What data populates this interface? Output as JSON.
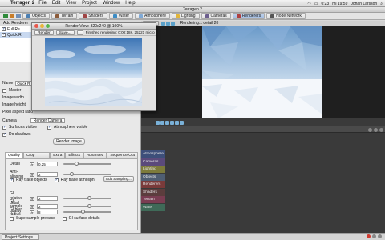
{
  "menubar": {
    "app": "Terragen 2",
    "items": [
      "File",
      "Edit",
      "View",
      "Project",
      "Window",
      "Help"
    ],
    "battery": "0:23",
    "clock": "mi 19:59",
    "user": "Johan Larsson"
  },
  "window": {
    "title": "Terragen 2"
  },
  "toolbar": {
    "tabs": [
      "Objects",
      "Terrain",
      "Shaders",
      "Water",
      "Atmosphere",
      "Lighting",
      "Cameras",
      "Renderers",
      "Node Network"
    ],
    "active_tab": "Renderers"
  },
  "left": {
    "add_renderer": "Add Renderer",
    "renderers": [
      "Full Re",
      "Quick R"
    ],
    "name_label": "Name",
    "name_value": "Quick R",
    "master_label": "Master",
    "image_width_label": "Image width",
    "image_height_label": "Image height",
    "pixel_aspect_label": "Pixel aspect ratio",
    "camera_label": "Camera",
    "camera_value": "Render Camera",
    "surfaces_visible": "Surfaces visible",
    "atmosphere_visible": "Atmosphere visible",
    "do_shadows": "Do shadows",
    "render_image": "Render Image",
    "subtabs": [
      "Quality",
      "Crop Region",
      "Extra",
      "Effects",
      "Advanced",
      "Sequence/Out"
    ],
    "quality": {
      "detail_label": "Detail",
      "detail_value": "0.25",
      "aa_label": "Anti-aliasing",
      "aa_value": "2",
      "ray_trace_objects": "Ray trace objects",
      "ray_trace_atmos": "Ray trace atmosph.",
      "edit_sampling": "Edit Sampling...",
      "gi_relative_label": "GI relative detail",
      "gi_relative_value": "2",
      "gi_sample_label": "GI sample quality",
      "gi_sample_value": "2",
      "gi_blur_label": "GI blur radius",
      "gi_blur_value": "8",
      "supersample": "Supersample prepass",
      "gi_surface": "GI surface details"
    }
  },
  "preview": {
    "reset": "Reset",
    "status": "Rendering... detail 20"
  },
  "render_window": {
    "title": "Render View: 320x240 @ 100%",
    "render_btn": "Render",
    "save_btn": "Save...",
    "status": "Finished rendering: 0:00:18s, 25221 micro"
  },
  "node_groups": [
    {
      "label": "Atmosphere",
      "color": "#3d4f7a"
    },
    {
      "label": "Cameras",
      "color": "#5b4a7b"
    },
    {
      "label": "Lighting",
      "color": "#7d7b3b"
    },
    {
      "label": "Objects",
      "color": "#4f5e72"
    },
    {
      "label": "Renderers",
      "color": "#7a3a3a"
    },
    {
      "label": "Shaders",
      "color": "#5c3d3d"
    },
    {
      "label": "Terrain",
      "color": "#7a3d52"
    },
    {
      "label": "Water",
      "color": "#3f6a58"
    }
  ],
  "statusbar": {
    "project_settings": "Project Settings..."
  }
}
